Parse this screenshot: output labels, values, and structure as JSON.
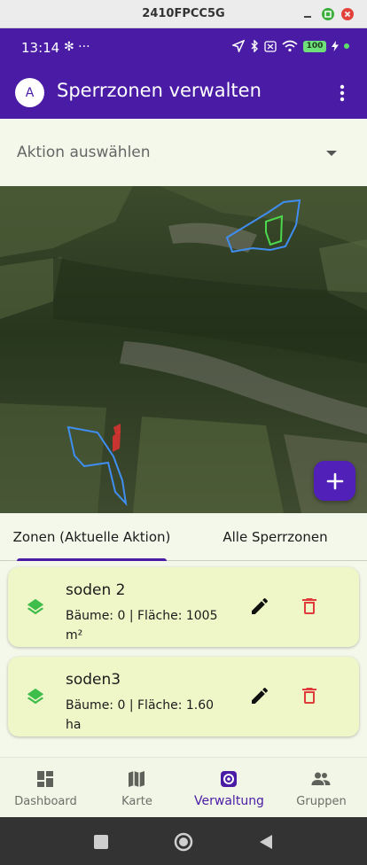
{
  "window": {
    "title": "2410FPCC5G"
  },
  "status_bar": {
    "time": "13:14",
    "left_icons": "✻ ···",
    "battery": "100"
  },
  "app_bar": {
    "avatar_letter": "A",
    "title": "Sperrzonen verwalten",
    "menu_icon": "more-vert-icon"
  },
  "dropdown": {
    "placeholder": "Aktion auswählen"
  },
  "map": {
    "fab_icon": "plus-icon",
    "zone_stroke_color": "#3f8ef0",
    "highlight_color": "#4cd84c",
    "marker_color": "#e23232"
  },
  "tabs": [
    {
      "label": "Zonen (Aktuelle Aktion)",
      "active": true
    },
    {
      "label": "Alle Sperrzonen",
      "active": false
    }
  ],
  "zones": [
    {
      "name": "soden 2",
      "details": "Bäume: 0 | Fläche: 1005 m²"
    },
    {
      "name": "soden3",
      "details": "Bäume: 0 | Fläche: 1.60 ha"
    }
  ],
  "bottom_nav": [
    {
      "label": "Dashboard",
      "icon": "dashboard-icon",
      "active": false
    },
    {
      "label": "Karte",
      "icon": "map-icon",
      "active": false
    },
    {
      "label": "Verwaltung",
      "icon": "settings-icon",
      "active": true
    },
    {
      "label": "Gruppen",
      "icon": "group-icon",
      "active": false
    }
  ],
  "colors": {
    "primary": "#4a1ca6",
    "card": "#eff6c8",
    "background": "#f3f8ea",
    "delete": "#e03b3b",
    "layer_icon": "#3ebd4a"
  }
}
